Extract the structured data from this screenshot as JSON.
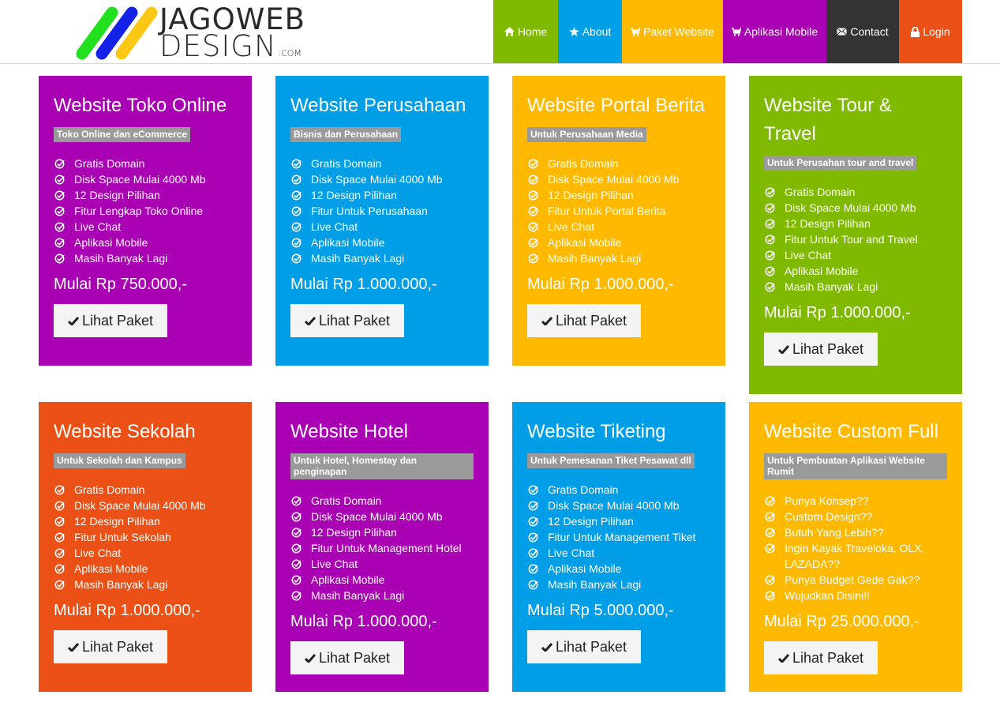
{
  "brand": {
    "line1": "JAGOWEB",
    "line2": "DESIGN",
    "suffix": ".COM",
    "stripe_colors": [
      "#22e01e",
      "#1422e8",
      "#fdc814"
    ]
  },
  "nav": [
    {
      "label": "Home",
      "icon": "home-icon",
      "color": "#7fba00"
    },
    {
      "label": "About",
      "icon": "star-icon",
      "color": "#00a0e8"
    },
    {
      "label": "Paket Website",
      "icon": "cart-icon",
      "color": "#ffb900"
    },
    {
      "label": "Aplikasi Mobile",
      "icon": "cart-icon",
      "color": "#aa00b4"
    },
    {
      "label": "Contact",
      "icon": "envelope-icon",
      "color": "#333333"
    },
    {
      "label": "Login",
      "icon": "lock-icon",
      "color": "#eb5016"
    }
  ],
  "cards": [
    {
      "title": "Website Toko Online",
      "subtitle": "Toko Online dan eCommerce",
      "color": "#aa00b4",
      "features": [
        "Gratis Domain",
        "Disk Space Mulai 4000 Mb",
        "12 Design Pilihan",
        "Fitur Lengkap Toko Online",
        "Live Chat",
        "Aplikasi Mobile",
        "Masih Banyak Lagi"
      ],
      "price": "Mulai Rp 750.000,-",
      "button": "Lihat Paket"
    },
    {
      "title": "Website Perusahaan",
      "subtitle": "Bisnis dan Perusahaan",
      "color": "#009ee6",
      "features": [
        "Gratis Domain",
        "Disk Space Mulai 4000 Mb",
        "12 Design Pilihan",
        "Fitur Untuk Perusahaan",
        "Live Chat",
        "Aplikasi Mobile",
        "Masih Banyak Lagi"
      ],
      "price": "Mulai Rp 1.000.000,-",
      "button": "Lihat Paket"
    },
    {
      "title": "Website Portal Berita",
      "subtitle": "Untuk Perusahaan Media",
      "color": "#ffb900",
      "features": [
        "Gratis Domain",
        "Disk Space Mulai 4000 Mb",
        "12 Design Pilihan",
        "Fitur Untuk Portal Berita",
        "Live Chat",
        "Aplikasi Mobile",
        "Masih Banyak Lagi"
      ],
      "price": "Mulai Rp 1.000.000,-",
      "button": "Lihat Paket"
    },
    {
      "title": "Website Tour & Travel",
      "subtitle": "Untuk Perusahan tour and travel",
      "color": "#7fba00",
      "features": [
        "Gratis Domain",
        "Disk Space Mulai 4000 Mb",
        "12 Design Pilihan",
        "Fitur Untuk Tour and Travel",
        "Live Chat",
        "Aplikasi Mobile",
        "Masih Banyak Lagi"
      ],
      "price": "Mulai Rp 1.000.000,-",
      "button": "Lihat Paket"
    },
    {
      "title": "Website Sekolah",
      "subtitle": "Untuk Sekolah dan Kampus",
      "color": "#eb5016",
      "features": [
        "Gratis Domain",
        "Disk Space Mulai 4000 Mb",
        "12 Design Pilihan",
        "Fitur Untuk Sekolah",
        "Live Chat",
        "Aplikasi Mobile",
        "Masih Banyak Lagi"
      ],
      "price": "Mulai Rp 1.000.000,-",
      "button": "Lihat Paket"
    },
    {
      "title": "Website Hotel",
      "subtitle": "Untuk Hotel, Homestay dan penginapan",
      "color": "#aa00b4",
      "features": [
        "Gratis Domain",
        "Disk Space Mulai 4000 Mb",
        "12 Design Pilihan",
        "Fitur Untuk Management Hotel",
        "Live Chat",
        "Aplikasi Mobile",
        "Masih Banyak Lagi"
      ],
      "price": "Mulai Rp 1.000.000,-",
      "button": "Lihat Paket"
    },
    {
      "title": "Website Tiketing",
      "subtitle": "Untuk Pemesanan Tiket Pesawat dll",
      "color": "#009ee6",
      "features": [
        "Gratis Domain",
        "Disk Space Mulai 4000 Mb",
        "12 Design Pilihan",
        "Fitur Untuk Management Tiket",
        "Live Chat",
        "Aplikasi Mobile",
        "Masih Banyak Lagi"
      ],
      "price": "Mulai Rp 5.000.000,-",
      "button": "Lihat Paket"
    },
    {
      "title": "Website Custom Full",
      "subtitle": "Untuk Pembuatan Aplikasi Website Rumit",
      "color": "#ffb900",
      "features": [
        "Punya Konsep??",
        "Custom Design??",
        "Butuh Yang Lebih??",
        "Ingin Kayak Traveloka, OLX, LAZADA??",
        "Punya Budget Gede Gak??",
        "Wujudkan Disini!!"
      ],
      "price": "Mulai Rp 25.000.000,-",
      "button": "Lihat Paket"
    }
  ]
}
